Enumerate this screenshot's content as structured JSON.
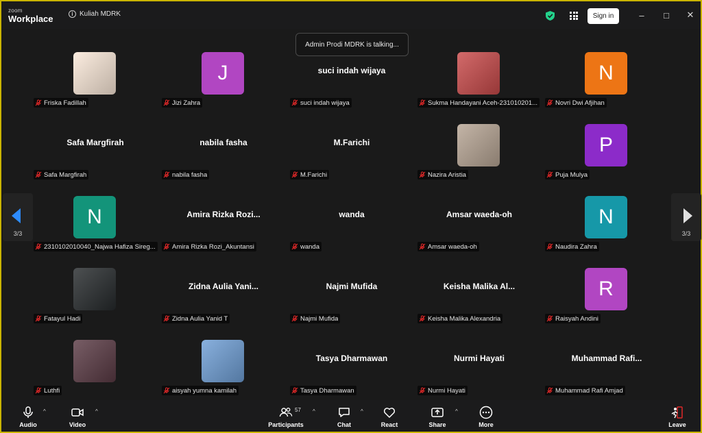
{
  "app": {
    "brand_small": "zoom",
    "brand_main": "Workplace",
    "meeting_title": "Kuliah MDRK",
    "sign_in": "Sign in"
  },
  "talking_banner": "Admin Prodi MDRK is talking...",
  "pager": {
    "left": "3/3",
    "right": "3/3"
  },
  "tiles": [
    {
      "name": "Friska Fadillah",
      "avatar": {
        "type": "photo",
        "color": "#fbe9d9"
      }
    },
    {
      "name": "Jizi Zahra",
      "avatar": {
        "type": "letter",
        "letter": "J",
        "color": "#b146c2"
      }
    },
    {
      "name": "suci indah wijaya",
      "display": "suci indah wijaya"
    },
    {
      "name": "Sukma Handayani Aceh-231010201...",
      "avatar": {
        "type": "photo",
        "color": "#c94a4a"
      }
    },
    {
      "name": "Novri Dwi Afjihan",
      "avatar": {
        "type": "letter",
        "letter": "N",
        "color": "#ed7515"
      }
    },
    {
      "name": "Safa Margfirah",
      "display": "Safa Margfirah"
    },
    {
      "name": "nabila fasha",
      "display": "nabila fasha"
    },
    {
      "name": "M.Farichi",
      "display": "M.Farichi"
    },
    {
      "name": "Nazira Aristia",
      "avatar": {
        "type": "photo",
        "color": "#b7a594"
      }
    },
    {
      "name": "Puja Mulya",
      "avatar": {
        "type": "letter",
        "letter": "P",
        "color": "#8c2bc9"
      }
    },
    {
      "name": "2310102010040_Najwa Hafiza Sireg...",
      "avatar": {
        "type": "letter",
        "letter": "N",
        "color": "#13947a"
      }
    },
    {
      "name": "Amira Rizka Rozi_Akuntansi",
      "display": "Amira Rizka Rozi..."
    },
    {
      "name": "wanda",
      "display": "wanda"
    },
    {
      "name": "Amsar waeda-oh",
      "display": "Amsar waeda-oh"
    },
    {
      "name": "Naudira Zahra",
      "avatar": {
        "type": "letter",
        "letter": "N",
        "color": "#1698a8"
      }
    },
    {
      "name": "Fatayul Hadi",
      "avatar": {
        "type": "photo",
        "color": "#262a2c"
      }
    },
    {
      "name": "Zidna Aulia Yanid T",
      "display": "Zidna Aulia Yani..."
    },
    {
      "name": "Najmi Mufida",
      "display": "Najmi Mufida"
    },
    {
      "name": "Keisha Malika Alexandria",
      "display": "Keisha Malika Al..."
    },
    {
      "name": "Raisyah Andini",
      "avatar": {
        "type": "letter",
        "letter": "R",
        "color": "#b146c2"
      }
    },
    {
      "name": "Luthfi",
      "avatar": {
        "type": "photo",
        "color": "#5a3a44"
      }
    },
    {
      "name": "aisyah yumna kamilah",
      "avatar": {
        "type": "photo",
        "color": "#6f9fd6"
      }
    },
    {
      "name": "Tasya Dharmawan",
      "display": "Tasya Dharmawan"
    },
    {
      "name": "Nurmi Hayati",
      "display": "Nurmi Hayati"
    },
    {
      "name": "Muhammad Rafi Amjad",
      "display": "Muhammad Rafi..."
    }
  ],
  "toolbar": {
    "audio": "Audio",
    "video": "Video",
    "participants": "Participants",
    "participants_count": "57",
    "chat": "Chat",
    "react": "React",
    "share": "Share",
    "more": "More",
    "leave": "Leave"
  },
  "colors": {
    "accent_blue": "#2d8cff",
    "secure_green": "#23d18b",
    "leave_red": "#e02828",
    "mic_off_red": "#e02828"
  }
}
